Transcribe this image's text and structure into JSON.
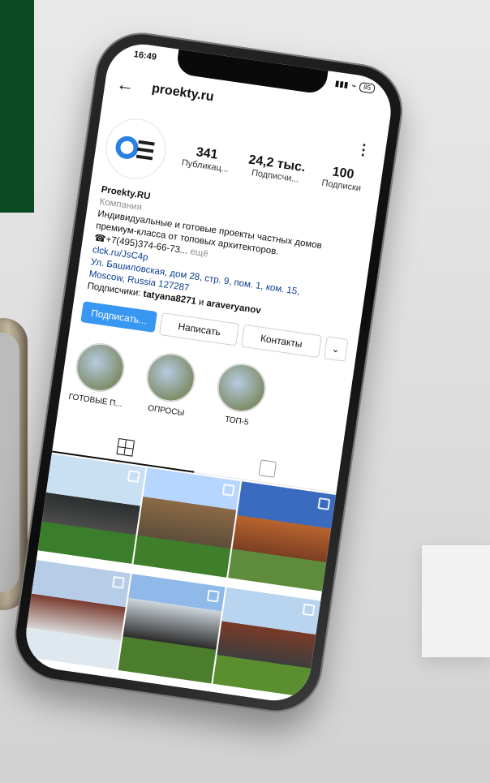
{
  "status": {
    "time": "16:49",
    "battery": "85"
  },
  "profile": {
    "username": "proekty.ru",
    "avatar_icon": "proekty-logo-icon",
    "stats": [
      {
        "value": "341",
        "label": "Публикац..."
      },
      {
        "value": "24,2 тыс.",
        "label": "Подписчи..."
      },
      {
        "value": "100",
        "label": "Подписки"
      }
    ],
    "name": "Proekty.RU",
    "category": "Компания",
    "bio_line1": "Индивидуальные и готовые проекты частных домов",
    "bio_line2": "премиум-класса от топовых архитекторов.",
    "phone": "☎+7(495)374-66-73...",
    "phone_more": "ещё",
    "link": "clck.ru/JsC4p",
    "address_line1": "Ул. Башиловская, дом 28, стр. 9, пом. 1, ком. 15,",
    "address_line2": "Moscow, Russia 127287",
    "followers_prefix": "Подписчики:",
    "followers_user1": "tatyana8271",
    "followers_and": "и",
    "followers_user2": "araveryanov"
  },
  "actions": {
    "subscribe": "Подписать...",
    "message": "Написать",
    "contacts": "Контакты"
  },
  "highlights": [
    {
      "label": "ГОТОВЫЕ П..."
    },
    {
      "label": "ОПРОСЫ"
    },
    {
      "label": "ТОП-5"
    }
  ],
  "tabs": [
    {
      "icon": "grid-icon",
      "active": true
    },
    {
      "icon": "tagged-icon",
      "active": false
    }
  ],
  "grid": {
    "items": [
      {
        "icon": "multi-photo-icon"
      },
      {
        "icon": "multi-photo-icon"
      },
      {
        "icon": "multi-photo-icon"
      },
      {
        "icon": "multi-photo-icon"
      },
      {
        "icon": "multi-photo-icon"
      },
      {
        "icon": "multi-photo-icon"
      }
    ]
  }
}
